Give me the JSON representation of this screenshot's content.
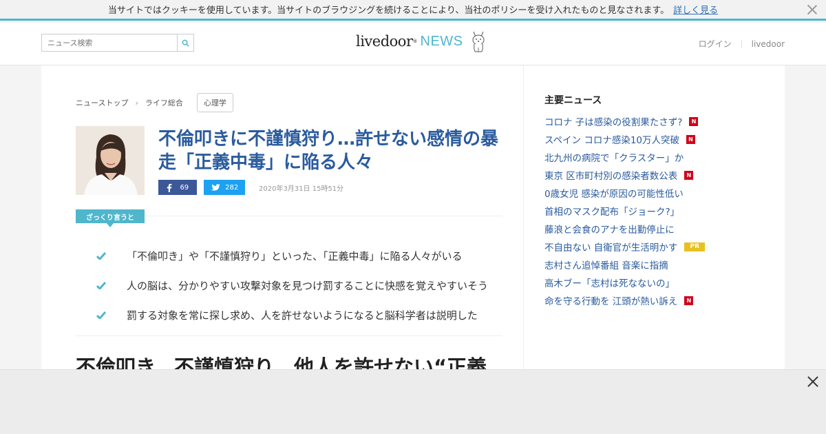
{
  "cookie_bar": {
    "message": "当サイトではクッキーを使用しています。当サイトのブラウジングを続けることにより、当社のポリシーを受け入れたものと見なされます。",
    "link": "詳しく見る"
  },
  "header": {
    "search_placeholder": "ニュース検索",
    "logo_main": "livedoor",
    "logo_reg": "®",
    "logo_news": "NEWS",
    "login": "ログイン",
    "livedoor_link": "livedoor"
  },
  "breadcrumb": {
    "items": [
      "ニューストップ",
      "ライフ総合"
    ],
    "separator": "›",
    "tag": "心理学"
  },
  "article": {
    "title": "不倫叩きに不謹慎狩り…許せない感情の暴走「正義中毒」に陥る人々",
    "facebook_count": "69",
    "twitter_count": "282",
    "date": "2020年3月31日 15時51分",
    "summary_label": "ざっくり言うと",
    "summary": [
      "「不倫叩き」や「不謹慎狩り」といった、「正義中毒」に陥る人々がいる",
      "人の脳は、分かりやすい攻撃対象を見つけ罰することに快感を覚えやすいそう",
      "罰する対象を常に探し求め、人を許せないようになると脳科学者は説明した"
    ],
    "headline": "不倫叩き、不謹慎狩り…他人を許せない“正義"
  },
  "sidebar": {
    "title": "主要ニュース",
    "items": [
      {
        "text": "コロナ 子は感染の役割果たさず?",
        "badge": "N"
      },
      {
        "text": "スペイン コロナ感染10万人突破",
        "badge": "N"
      },
      {
        "text": "北九州の病院で「クラスター」か",
        "badge": ""
      },
      {
        "text": "東京 区市町村別の感染者数公表",
        "badge": "N"
      },
      {
        "text": "0歳女児 感染が原因の可能性低い",
        "badge": ""
      },
      {
        "text": "首相のマスク配布「ジョーク?」",
        "badge": ""
      },
      {
        "text": "藤浪と会食のアナを出勤停止に",
        "badge": ""
      },
      {
        "text": "不自由ない 自衛官が生活明かす",
        "badge": "PR"
      },
      {
        "text": "志村さん追悼番組 音楽に指摘",
        "badge": ""
      },
      {
        "text": "高木ブー「志村は死なないの」",
        "badge": ""
      },
      {
        "text": "命を守る行動を 江頭が熱い訴え",
        "badge": "N"
      }
    ]
  },
  "colors": {
    "accent": "#4fb6cc",
    "link": "#2a5b9e",
    "facebook": "#3b5998",
    "twitter": "#1da1f2",
    "badge_new": "#d0021b",
    "badge_pr": "#e8c11e"
  },
  "icons": {
    "cookie_close": "close-icon",
    "search": "search-icon",
    "mascot": "dog-mascot-icon",
    "facebook": "facebook-icon",
    "twitter": "twitter-icon",
    "check": "check-icon",
    "ad_close": "close-icon"
  }
}
